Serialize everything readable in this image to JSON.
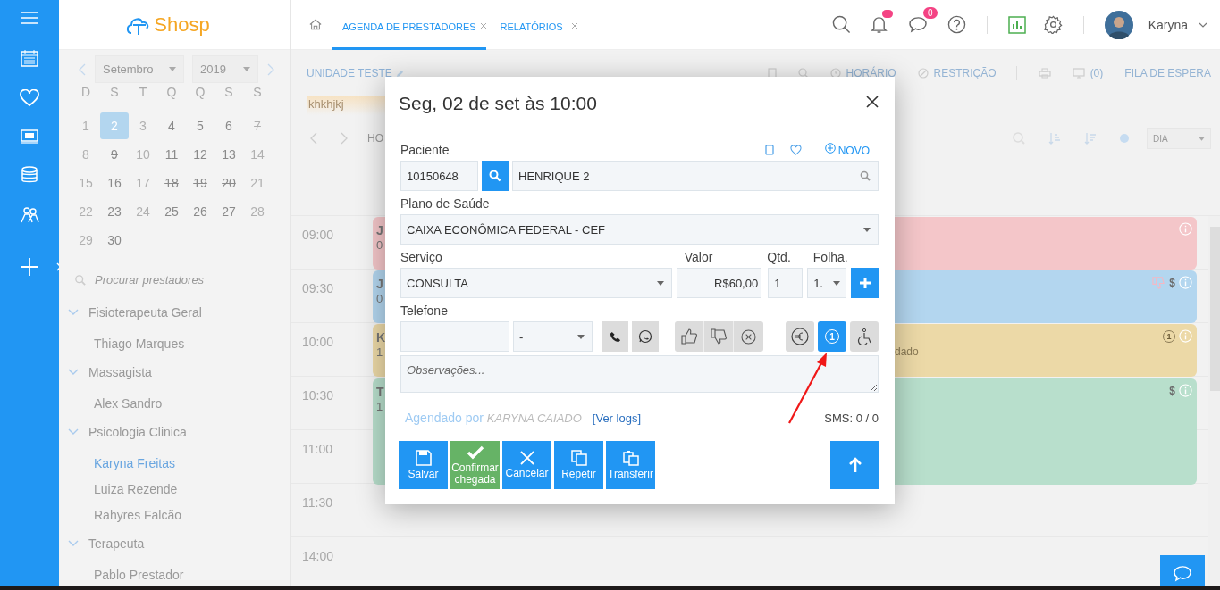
{
  "brand": {
    "logo": "Shosp"
  },
  "tabs": [
    {
      "label": "AGENDA DE PRESTADORES",
      "selected": true
    },
    {
      "label": "RELATÓRIOS",
      "selected": false
    }
  ],
  "header": {
    "notifications_unread": true,
    "messages_badge": "0",
    "user": "Karyna"
  },
  "calendar": {
    "month": "Setembro",
    "year": "2019",
    "weekdays": [
      "D",
      "S",
      "T",
      "Q",
      "Q",
      "S",
      "S"
    ],
    "days": [
      {
        "label": "1",
        "available": false,
        "blocked": false,
        "selected": false
      },
      {
        "label": "2",
        "available": true,
        "blocked": false,
        "selected": true
      },
      {
        "label": "3",
        "available": false,
        "blocked": false,
        "selected": false
      },
      {
        "label": "4",
        "available": true,
        "blocked": false,
        "selected": false
      },
      {
        "label": "5",
        "available": true,
        "blocked": false,
        "selected": false
      },
      {
        "label": "6",
        "available": true,
        "blocked": false,
        "selected": false
      },
      {
        "label": "7",
        "available": false,
        "blocked": true,
        "selected": false
      },
      {
        "label": "8",
        "available": false,
        "blocked": false,
        "selected": false
      },
      {
        "label": "9",
        "available": true,
        "blocked": true,
        "selected": false
      },
      {
        "label": "10",
        "available": false,
        "blocked": false,
        "selected": false
      },
      {
        "label": "11",
        "available": true,
        "blocked": false,
        "selected": false
      },
      {
        "label": "12",
        "available": true,
        "blocked": false,
        "selected": false
      },
      {
        "label": "13",
        "available": true,
        "blocked": false,
        "selected": false
      },
      {
        "label": "14",
        "available": false,
        "blocked": false,
        "selected": false
      },
      {
        "label": "15",
        "available": false,
        "blocked": false,
        "selected": false
      },
      {
        "label": "16",
        "available": true,
        "blocked": false,
        "selected": false
      },
      {
        "label": "17",
        "available": false,
        "blocked": false,
        "selected": false
      },
      {
        "label": "18",
        "available": true,
        "blocked": true,
        "selected": false
      },
      {
        "label": "19",
        "available": true,
        "blocked": true,
        "selected": false
      },
      {
        "label": "20",
        "available": true,
        "blocked": true,
        "selected": false
      },
      {
        "label": "21",
        "available": false,
        "blocked": false,
        "selected": false
      },
      {
        "label": "22",
        "available": false,
        "blocked": false,
        "selected": false
      },
      {
        "label": "23",
        "available": true,
        "blocked": false,
        "selected": false
      },
      {
        "label": "24",
        "available": false,
        "blocked": false,
        "selected": false
      },
      {
        "label": "25",
        "available": true,
        "blocked": false,
        "selected": false
      },
      {
        "label": "26",
        "available": true,
        "blocked": false,
        "selected": false
      },
      {
        "label": "27",
        "available": true,
        "blocked": false,
        "selected": false
      },
      {
        "label": "28",
        "available": false,
        "blocked": false,
        "selected": false
      },
      {
        "label": "29",
        "available": false,
        "blocked": false,
        "selected": false
      },
      {
        "label": "30",
        "available": true,
        "blocked": false,
        "selected": false
      }
    ]
  },
  "provider_search": {
    "placeholder": "Procurar prestadores"
  },
  "providers": [
    {
      "label": "Fisioterapeuta Geral",
      "expanded": true,
      "children": [
        {
          "label": "Thiago Marques",
          "selected": false
        }
      ]
    },
    {
      "label": "Massagista",
      "expanded": true,
      "children": [
        {
          "label": "Alex Sandro",
          "selected": false
        }
      ]
    },
    {
      "label": "Psicologia Clinica",
      "expanded": true,
      "children": [
        {
          "label": "Karyna Freitas",
          "selected": true
        },
        {
          "label": "Luiza Rezende",
          "selected": false
        },
        {
          "label": "Rahyres Falcão",
          "selected": false
        }
      ]
    },
    {
      "label": "Terapeuta",
      "expanded": true,
      "children": [
        {
          "label": "Pablo Prestador",
          "selected": false
        }
      ]
    }
  ],
  "toolbar": {
    "unit": "UNIDADE TESTE",
    "actions": [
      {
        "kind": "book"
      },
      {
        "kind": "search"
      },
      {
        "kind": "clock",
        "label": "HORÁRIO"
      },
      {
        "kind": "block",
        "label": "RESTRIÇÃO"
      },
      {
        "kind": "divider"
      },
      {
        "kind": "print"
      },
      {
        "kind": "monitor",
        "label": "(0)"
      },
      {
        "kind": "text",
        "label": "FILA DE ESPERA"
      }
    ],
    "banner": "khkhjkj",
    "nav_label": "HO",
    "view": "DIA"
  },
  "times": [
    "09:00",
    "09:30",
    "10:00",
    "10:30",
    "11:00",
    "11:30",
    "14:00"
  ],
  "events": [
    {
      "color": "#f4c6c9",
      "extended": false,
      "title": "J",
      "subtitle": "0",
      "icons": [
        {
          "kind": "info"
        }
      ]
    },
    {
      "color": "#b3d6ef",
      "extended": false,
      "title": "J",
      "subtitle": "0",
      "icons": [
        {
          "kind": "thumbs-down"
        },
        {
          "kind": "dollar",
          "text": "$"
        },
        {
          "kind": "info"
        }
      ]
    },
    {
      "color": "#ecd9a7",
      "extended": false,
      "title": "K",
      "subtitle": "1",
      "note": "dado",
      "icons": [
        {
          "kind": "count",
          "text": "1"
        },
        {
          "kind": "info"
        }
      ]
    },
    {
      "color": "#b8dfcc",
      "extended": true,
      "title": "T",
      "subtitle": "1",
      "icons": [
        {
          "kind": "dollar",
          "text": "$"
        },
        {
          "kind": "info"
        }
      ]
    }
  ],
  "modal": {
    "title": "Seg, 02 de set às 10:00",
    "patient": {
      "label": "Paciente",
      "new_label": "NOVO",
      "id": "10150648",
      "name": "HENRIQUE 2"
    },
    "plan": {
      "label": "Plano de Saúde",
      "value": "CAIXA ECONÔMICA FEDERAL - CEF"
    },
    "service": {
      "label": "Serviço",
      "value": "CONSULTA"
    },
    "price": {
      "label": "Valor",
      "value": "R$60,00"
    },
    "quantity": {
      "label": "Qtd.",
      "value": "1"
    },
    "sheet": {
      "label": "Folha.",
      "value": "1."
    },
    "phone": {
      "label": "Telefone",
      "type": "-"
    },
    "reactions": [
      {
        "kind": "like",
        "selected": false
      },
      {
        "kind": "dislike",
        "selected": false
      },
      {
        "kind": "cancel",
        "selected": false
      }
    ],
    "toggles": [
      {
        "kind": "euro",
        "selected": false
      },
      {
        "kind": "count",
        "text": "1",
        "selected": true
      },
      {
        "kind": "wheelchair",
        "selected": false
      }
    ],
    "notes": {
      "placeholder": "Observações..."
    },
    "scheduled_by": {
      "label": "Agendado por",
      "name": "KARYNA CAIADO",
      "logs": "[Ver logs]"
    },
    "sms": "SMS: 0 / 0",
    "buttons": [
      {
        "kind": "save",
        "label": "Salvar"
      },
      {
        "kind": "confirm",
        "label": "Confirmar chegada"
      },
      {
        "kind": "cancel",
        "label": "Cancelar"
      },
      {
        "kind": "repeat",
        "label": "Repetir"
      },
      {
        "kind": "transfer",
        "label": "Transferir"
      }
    ]
  }
}
